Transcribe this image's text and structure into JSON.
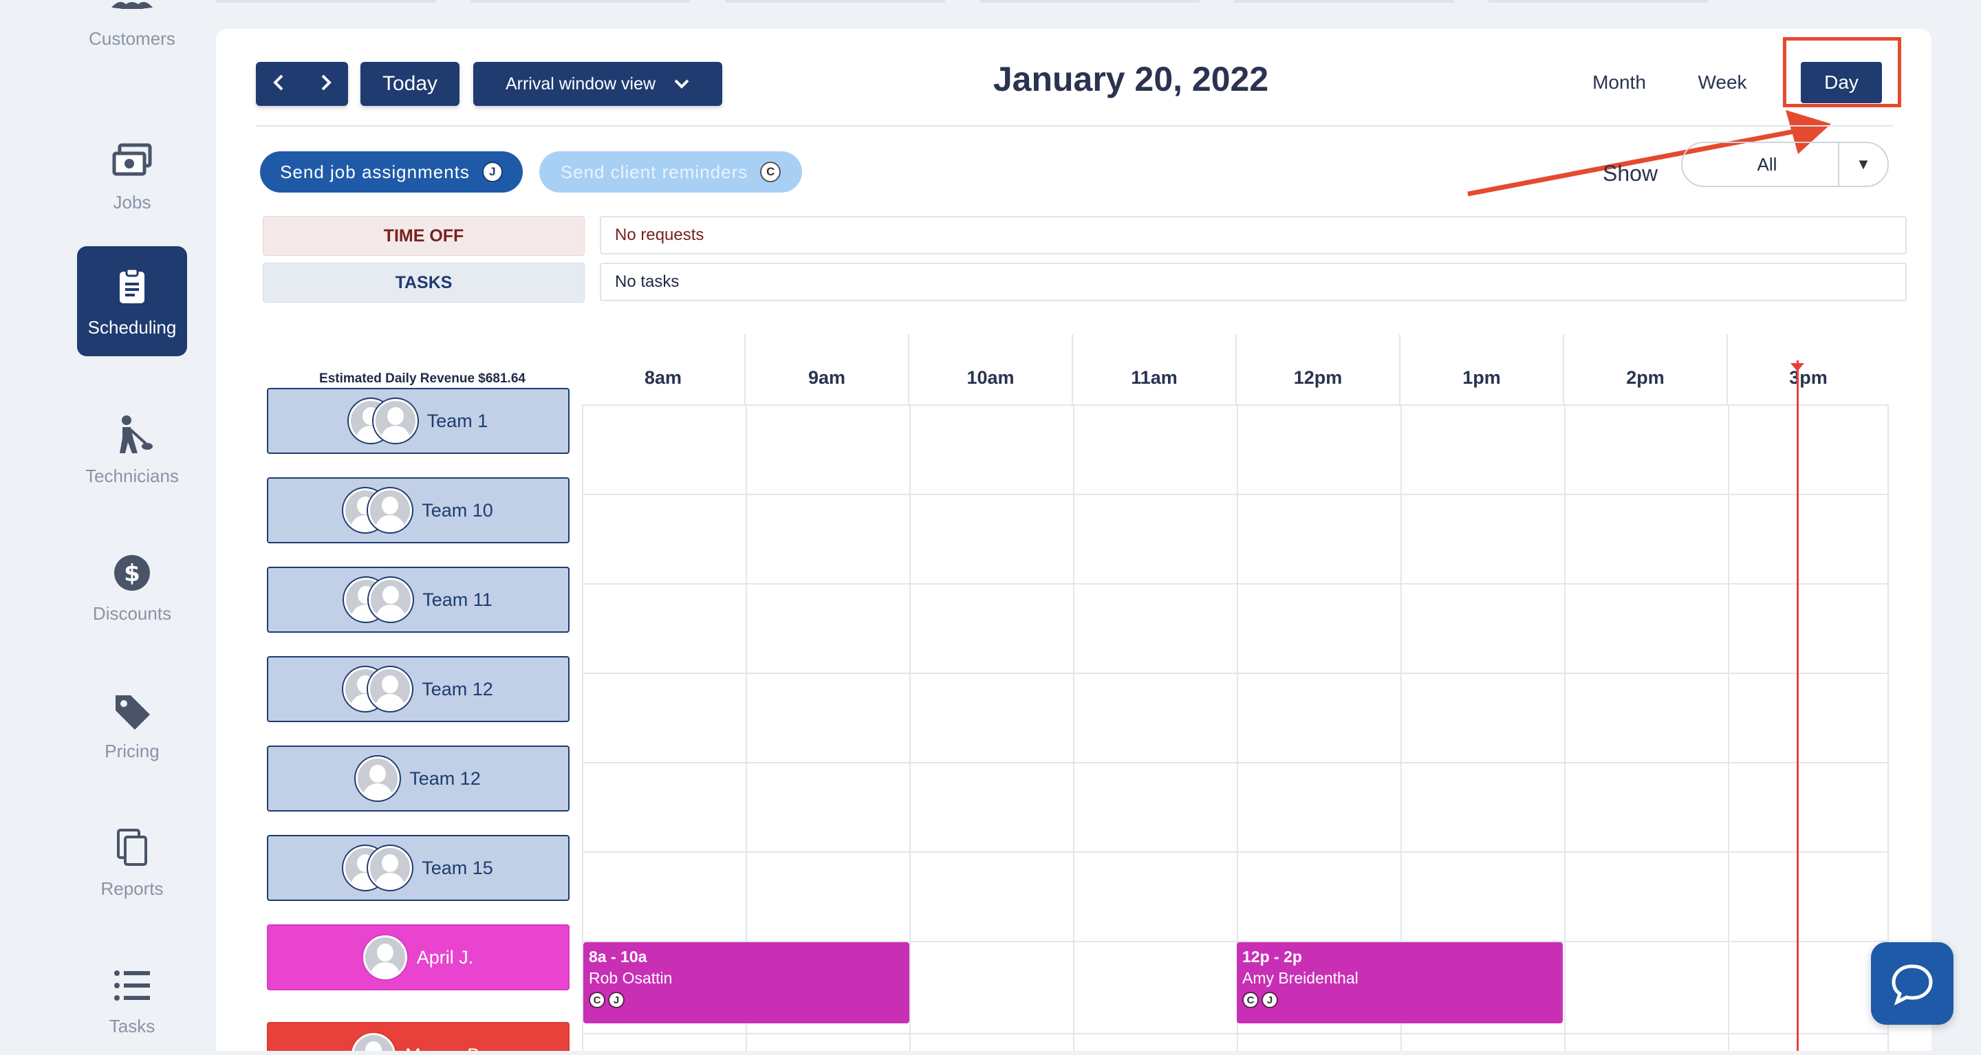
{
  "sidebar": {
    "items": [
      {
        "label": "Customers",
        "icon": "customers-icon"
      },
      {
        "label": "Jobs",
        "icon": "jobs-icon"
      },
      {
        "label": "Scheduling",
        "icon": "clipboard-icon",
        "active": true
      },
      {
        "label": "Technicians",
        "icon": "technician-icon"
      },
      {
        "label": "Discounts",
        "icon": "dollar-icon"
      },
      {
        "label": "Pricing",
        "icon": "tag-icon"
      },
      {
        "label": "Reports",
        "icon": "copy-icon"
      },
      {
        "label": "Tasks",
        "icon": "list-icon"
      }
    ]
  },
  "toolbar": {
    "today_label": "Today",
    "view_label": "Arrival window view",
    "date_title": "January 20, 2022",
    "tabs": {
      "month": "Month",
      "week": "Week",
      "day": "Day"
    },
    "active_tab": "Day"
  },
  "actions": {
    "send_jobs_label": "Send job assignments",
    "send_jobs_badge": "J",
    "send_clients_label": "Send client reminders",
    "send_clients_badge": "C"
  },
  "filter": {
    "show_label": "Show",
    "show_value": "All"
  },
  "info_rows": {
    "time_off_label": "TIME OFF",
    "time_off_value": "No requests",
    "tasks_label": "TASKS",
    "tasks_value": "No tasks"
  },
  "schedule": {
    "revenue_text": "Estimated Daily Revenue $681.64",
    "hours": [
      "8am",
      "9am",
      "10am",
      "11am",
      "12pm",
      "1pm",
      "2pm",
      "3pm"
    ],
    "teams": [
      {
        "name": "Team 1",
        "avatars": 2
      },
      {
        "name": "Team 10",
        "avatars": 2
      },
      {
        "name": "Team 11",
        "avatars": 2
      },
      {
        "name": "Team 12",
        "avatars": 2
      },
      {
        "name": "Team 12",
        "avatars": 1
      },
      {
        "name": "Team 15",
        "avatars": 2
      },
      {
        "name": "April J.",
        "avatars": 1
      },
      {
        "name": "Megan B.",
        "avatars": 1
      }
    ],
    "jobs": [
      {
        "time": "8a - 10a",
        "client": "Rob Osattin",
        "badges": [
          "C",
          "J"
        ]
      },
      {
        "time": "12p - 2p",
        "client": "Amy Breidenthal",
        "badges": [
          "C",
          "J"
        ]
      }
    ]
  },
  "colors": {
    "primary": "#1f3b70",
    "accent_pink": "#c92fb5",
    "team_pink": "#e944cf",
    "now_red": "#e8413a",
    "annotation_red": "#e64a2e"
  }
}
